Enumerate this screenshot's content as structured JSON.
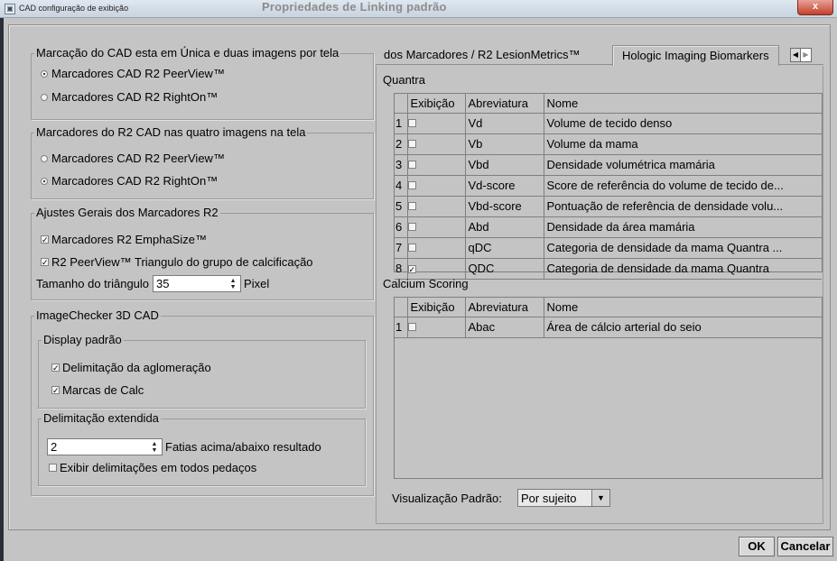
{
  "window": {
    "title": "CAD configuração de exibição",
    "background_title": "Propriedades de Linking padrão",
    "close_label": "x"
  },
  "left": {
    "group1": {
      "title": "Marcação do CAD esta em Única e duas imagens por tela",
      "options": [
        "Marcadores CAD  R2 PeerView™",
        "Marcadores CAD R2 RightOn™"
      ],
      "selected_index": 0
    },
    "group2": {
      "title": "Marcadores do R2 CAD  nas quatro imagens na tela",
      "options": [
        "Marcadores CAD  R2 PeerView™",
        "Marcadores CAD R2 RightOn™"
      ],
      "selected_index": 1
    },
    "group3": {
      "title": "Ajustes Gerais dos Marcadores R2",
      "check1": "Marcadores R2 EmphaSize™",
      "check2": "R2 PeerView™ Triangulo  do grupo de calcificação",
      "triangle_label": "Tamanho do triângulo",
      "triangle_value": "35",
      "triangle_unit": "Pixel"
    },
    "group4": {
      "title": "ImageChecker 3D CAD",
      "display": {
        "title": "Display padrão",
        "check1": "Delimitação da aglomeração",
        "check2": "Marcas de Calc"
      },
      "extended": {
        "title": "Delimitação extendida",
        "value": "2",
        "spin_label": "Fatias acima/abaixo resultado",
        "check": "Exibir delimitações em todos pedaços"
      }
    }
  },
  "right": {
    "tabs": [
      "dos Marcadores / R2 LesionMetrics™",
      "Hologic Imaging Biomarkers"
    ],
    "active_tab": 1,
    "quantra": {
      "label": "Quantra",
      "columns": [
        "Exibição",
        "Abreviatura",
        "Nome"
      ],
      "rows": [
        {
          "idx": "1",
          "checked": false,
          "abbr": "Vd",
          "name": "Volume de tecido denso"
        },
        {
          "idx": "2",
          "checked": false,
          "abbr": "Vb",
          "name": "Volume da mama"
        },
        {
          "idx": "3",
          "checked": false,
          "abbr": "Vbd",
          "name": "Densidade volumétrica mamária"
        },
        {
          "idx": "4",
          "checked": false,
          "abbr": "Vd-score",
          "name": "Score de referência do volume de tecido de..."
        },
        {
          "idx": "5",
          "checked": false,
          "abbr": "Vbd-score",
          "name": "Pontuação de referência de densidade volu..."
        },
        {
          "idx": "6",
          "checked": false,
          "abbr": "Abd",
          "name": "Densidade da área mamária"
        },
        {
          "idx": "7",
          "checked": false,
          "abbr": "qDC",
          "name": "Categoria de densidade da mama Quantra ..."
        },
        {
          "idx": "8",
          "checked": true,
          "abbr": "QDC",
          "name": "Categoria de densidade da mama Quantra"
        }
      ]
    },
    "calcium": {
      "label": "Calcium Scoring",
      "columns": [
        "Exibição",
        "Abreviatura",
        "Nome"
      ],
      "rows": [
        {
          "idx": "1",
          "checked": false,
          "abbr": "Abac",
          "name": "Área de cálcio arterial do seio"
        }
      ]
    },
    "default_view": {
      "label": "Visualização Padrão:",
      "value": "Por sujeito"
    }
  },
  "footer": {
    "ok": "OK",
    "cancel": "Cancelar"
  },
  "icons": {
    "checkmark": "✓",
    "spin_up": "▲",
    "spin_down": "▼",
    "dropdown": "▼",
    "tab_left": "◀",
    "tab_right": "▶"
  }
}
